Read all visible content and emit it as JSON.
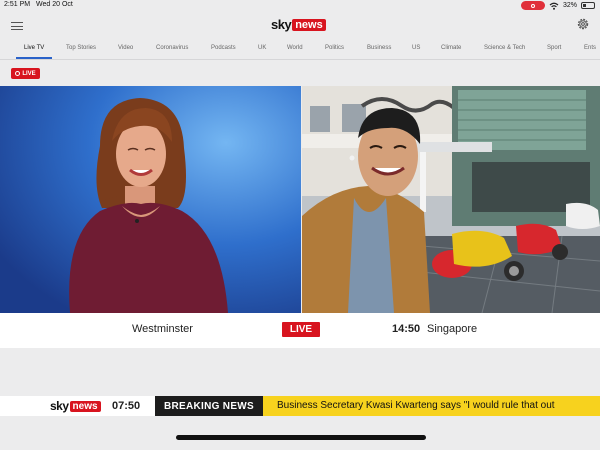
{
  "status_bar": {
    "time": "2:51 PM",
    "date": "Wed 20 Oct",
    "battery": "32%",
    "battery_level": 0.32
  },
  "header": {
    "logo_sky": "sky",
    "logo_news": "news"
  },
  "nav": {
    "tabs": [
      "Live TV",
      "Top Stories",
      "Video",
      "Coronavirus",
      "Podcasts",
      "UK",
      "World",
      "Politics",
      "Business",
      "US",
      "Climate",
      "Science & Tech",
      "Sport",
      "Ents"
    ],
    "active": "Live TV"
  },
  "live_badge_top": "LIVE",
  "lower_third": {
    "left_location": "Westminster",
    "live_label": "LIVE",
    "right_time": "14:50",
    "right_location": "Singapore"
  },
  "ticker": {
    "logo_sky": "sky",
    "logo_news": "news",
    "time": "07:50",
    "breaking_label": "BREAKING NEWS",
    "headline": "Business Secretary Kwasi Kwarteng says \"I would rule that out"
  },
  "icons": {
    "menu": "menu-icon",
    "settings": "gear-icon",
    "wifi": "wifi-icon",
    "battery": "battery-icon",
    "record": "screen-record-icon"
  },
  "colors": {
    "sky_red": "#d8141f",
    "breaking_bg": "#1d1d1d",
    "ticker_yellow": "#f7d21e",
    "active_tab_underline": "#2a62c9"
  }
}
